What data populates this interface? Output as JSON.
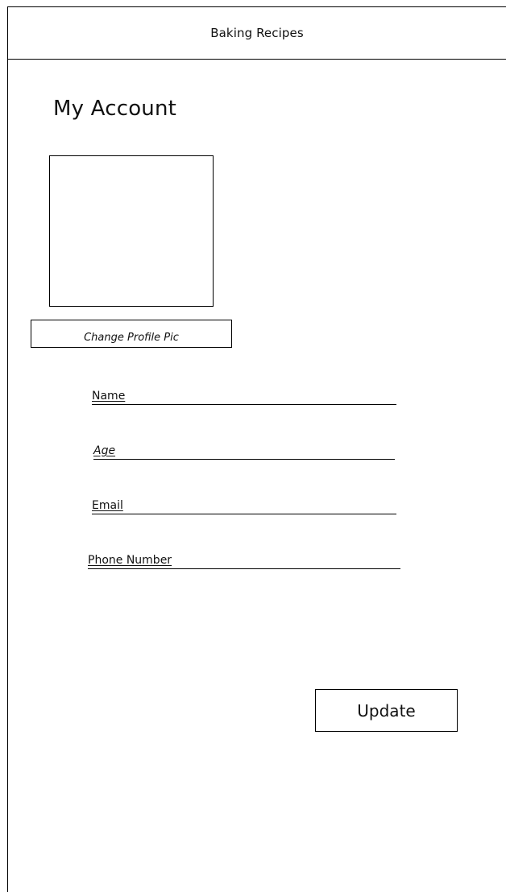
{
  "header": {
    "title": "Baking Recipes"
  },
  "main": {
    "title": "My Account",
    "change_pic_label": "Change Profile Pic",
    "fields": {
      "name_label": "Name",
      "age_label": "Age",
      "email_label": "Email",
      "phone_label": "Phone Number"
    },
    "update_label": "Update"
  }
}
